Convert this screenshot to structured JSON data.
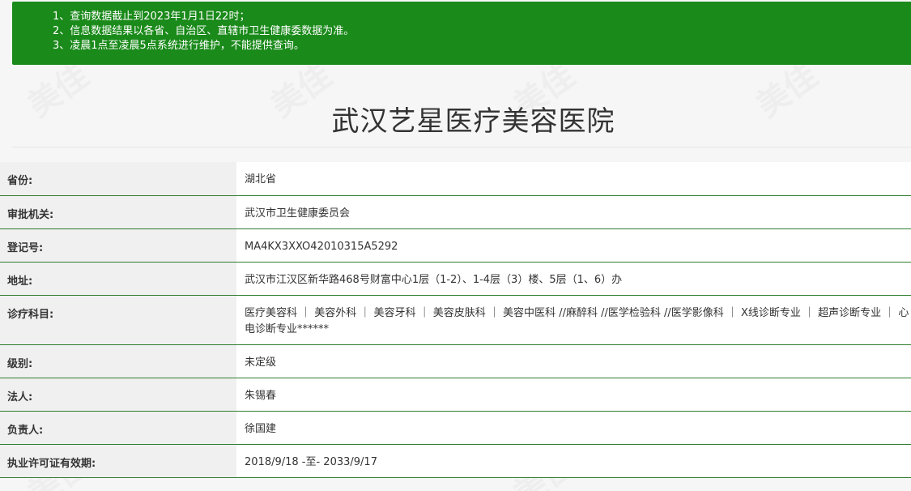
{
  "notice": {
    "lines": [
      "1、查询数据截止到2023年1月1日22时；",
      "2、信息数据结果以各省、自治区、直辖市卫生健康委数据为准。",
      "3、凌晨1点至凌晨5点系统进行维护，不能提供查询。"
    ]
  },
  "title": "武汉艺星医疗美容医院",
  "rows": [
    {
      "label": "省份:",
      "value": "湖北省"
    },
    {
      "label": "审批机关:",
      "value": "武汉市卫生健康委员会"
    },
    {
      "label": "登记号:",
      "value": "MA4KX3XXO42010315A5292"
    },
    {
      "label": "地址:",
      "value": "武汉市江汉区新华路468号财富中心1层（1-2）、1-4层（3）楼、5层（1、6）办"
    },
    {
      "label": "诊疗科目:",
      "value": "医疗美容科 ｜ 美容外科 ｜ 美容牙科 ｜ 美容皮肤科 ｜ 美容中医科 //麻醉科 //医学检验科 //医学影像科 ｜ X线诊断专业 ｜ 超声诊断专业 ｜ 心电诊断专业******"
    },
    {
      "label": "级别:",
      "value": "未定级"
    },
    {
      "label": "法人:",
      "value": "朱锡春"
    },
    {
      "label": "负责人:",
      "value": "徐国建"
    },
    {
      "label": "执业许可证有效期:",
      "value": "2018/9/18 -至- 2033/9/17"
    }
  ],
  "watermark": {
    "text": "美佳"
  },
  "colors": {
    "notice_bg": "#1a8a1a",
    "row_border": "#2f7d2f",
    "label_bg": "#f0f0f0",
    "value_bg": "#ffffff"
  }
}
